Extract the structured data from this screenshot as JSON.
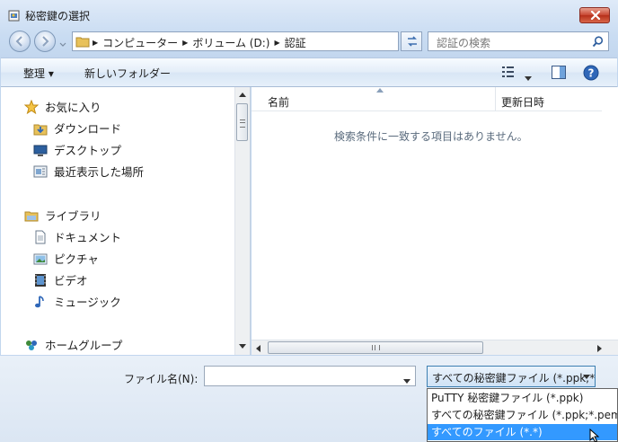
{
  "window": {
    "title": "秘密鍵の選択",
    "close_icon": "close-icon"
  },
  "address": {
    "breadcrumb": [
      "コンピューター",
      "ボリューム (D:)",
      "認証"
    ],
    "search_placeholder": "認証の検索"
  },
  "toolbar": {
    "organize_label": "整理 ▾",
    "new_folder_label": "新しいフォルダー"
  },
  "sidebar": {
    "items": [
      {
        "label": "お気に入り",
        "icon": "star-icon"
      },
      {
        "label": "ダウンロード",
        "icon": "download-folder-icon"
      },
      {
        "label": "デスクトップ",
        "icon": "desktop-icon"
      },
      {
        "label": "最近表示した場所",
        "icon": "recent-places-icon"
      },
      {
        "label": "ライブラリ",
        "icon": "library-icon"
      },
      {
        "label": "ドキュメント",
        "icon": "document-icon"
      },
      {
        "label": "ピクチャ",
        "icon": "picture-icon"
      },
      {
        "label": "ビデオ",
        "icon": "video-icon"
      },
      {
        "label": "ミュージック",
        "icon": "music-icon"
      },
      {
        "label": "ホームグループ",
        "icon": "homegroup-icon"
      }
    ]
  },
  "file_list": {
    "columns": [
      "名前",
      "更新日時"
    ],
    "empty_message": "検索条件に一致する項目はありません。"
  },
  "footer": {
    "filename_label": "ファイル名(N):",
    "filename_value": "",
    "filetype_selected": "すべての秘密鍵ファイル (*.ppk;*.pem)",
    "filetype_options": [
      "PuTTY 秘密鍵ファイル (*.ppk)",
      "すべての秘密鍵ファイル (*.ppk;*.pem)",
      "すべてのファイル (*.*)"
    ],
    "highlighted_option_index": 2
  },
  "colors": {
    "selection": "#3399ff",
    "close_button": "#c7442f",
    "chrome": "#c9dcf2"
  }
}
